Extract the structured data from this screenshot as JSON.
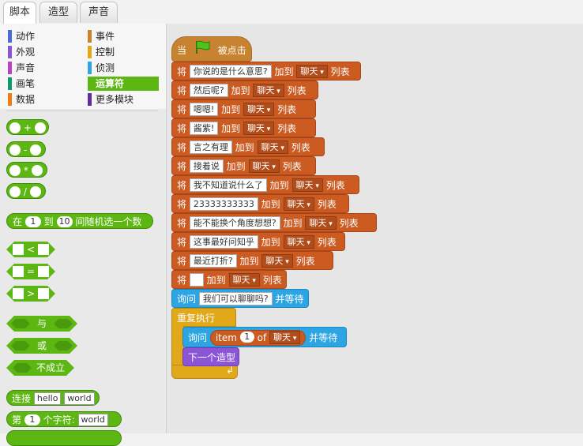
{
  "tabs": [
    "脚本",
    "造型",
    "声音"
  ],
  "categories": [
    {
      "label": "动作",
      "color": "#4a6cd4"
    },
    {
      "label": "事件",
      "color": "#c88330"
    },
    {
      "label": "外观",
      "color": "#8a55d7"
    },
    {
      "label": "控制",
      "color": "#e1a91a"
    },
    {
      "label": "声音",
      "color": "#bb42c3"
    },
    {
      "label": "侦测",
      "color": "#2ca5e2"
    },
    {
      "label": "画笔",
      "color": "#0e9a6c"
    },
    {
      "label": "运算符",
      "color": "#5cb712"
    },
    {
      "label": "数据",
      "color": "#ee7d16"
    },
    {
      "label": "更多模块",
      "color": "#632d99"
    }
  ],
  "palette": {
    "add": "+",
    "sub": "-",
    "mul": "*",
    "div": "/",
    "random": {
      "pre": "在",
      "from": "1",
      "mid": "到",
      "to": "10",
      "post": "间随机选一个数"
    },
    "lt": "<",
    "eq": "=",
    "gt": ">",
    "and": "与",
    "or": "或",
    "not": "不成立",
    "join": {
      "label": "连接",
      "a": "hello",
      "b": "world"
    },
    "letter": {
      "pre": "第",
      "n": "1",
      "mid": "个字符:",
      "s": "world"
    }
  },
  "script": {
    "hat": {
      "when": "当",
      "clicked": "被点击"
    },
    "add_word": "加到",
    "list_word": "列表",
    "set_word": "将",
    "list_name": "聊天",
    "items": [
      "你说的是什么意思?",
      "然后呢?",
      "嗯嗯!",
      "酱紫!",
      "言之有理",
      "接着说",
      "我不知道说什么了",
      "23333333333",
      "能不能换个角度想想?",
      "这事最好问知乎",
      "最近打折?",
      ""
    ],
    "ask1": {
      "label": "询问",
      "text": "我们可以聊聊吗?",
      "wait": "并等待"
    },
    "forever": "重复执行",
    "ask2": {
      "label": "询问",
      "item": "item",
      "index": "1",
      "of": "of",
      "list": "聊天",
      "wait": "并等待"
    },
    "next_costume": "下一个造型"
  }
}
